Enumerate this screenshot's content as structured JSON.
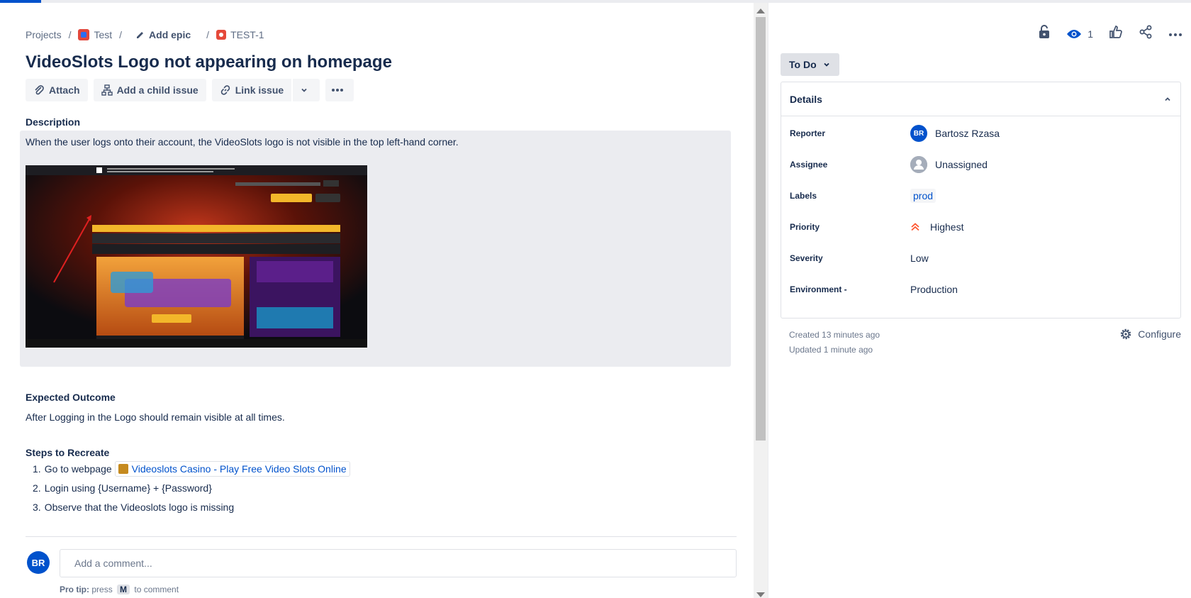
{
  "breadcrumb": {
    "projects": "Projects",
    "project": "Test",
    "add_epic": "Add epic",
    "issue_key": "TEST-1"
  },
  "issue": {
    "title": "VideoSlots Logo not appearing on homepage"
  },
  "toolbar": {
    "attach": "Attach",
    "add_child": "Add a child issue",
    "link_issue": "Link issue"
  },
  "description": {
    "heading": "Description",
    "text": "When the user logs onto their account, the VideoSlots logo is not visible in the top left-hand corner.",
    "image_alt": "Screenshot of Videoslots homepage"
  },
  "expected": {
    "heading": "Expected Outcome",
    "text": "After Logging in the Logo should remain visible at all times."
  },
  "steps": {
    "heading": "Steps to Recreate",
    "items": [
      {
        "num": "1.",
        "text": "Go to webpage",
        "link": "Videoslots Casino - Play Free Video Slots Online"
      },
      {
        "num": "2.",
        "text": "Login using {Username} + {Password}"
      },
      {
        "num": "3.",
        "text": "Observe that the Videoslots logo is missing"
      }
    ]
  },
  "comment": {
    "avatar_initials": "BR",
    "placeholder": "Add a comment...",
    "protip_label": "Pro tip:",
    "protip_pre": "press",
    "protip_key": "M",
    "protip_post": "to comment"
  },
  "side": {
    "watch_count": "1",
    "status": "To Do",
    "details_heading": "Details",
    "fields": {
      "reporter_label": "Reporter",
      "reporter_initials": "BR",
      "reporter": "Bartosz Rzasa",
      "assignee_label": "Assignee",
      "assignee": "Unassigned",
      "labels_label": "Labels",
      "label": "prod",
      "priority_label": "Priority",
      "priority": "Highest",
      "severity_label": "Severity",
      "severity": "Low",
      "environment_label": "Environment -",
      "environment": "Production"
    },
    "created": "Created 13 minutes ago",
    "updated": "Updated 1 minute ago",
    "configure": "Configure"
  },
  "colors": {
    "accent": "#0052cc",
    "priority_highest": "#ff5630",
    "issue_type": "#e5493a"
  }
}
